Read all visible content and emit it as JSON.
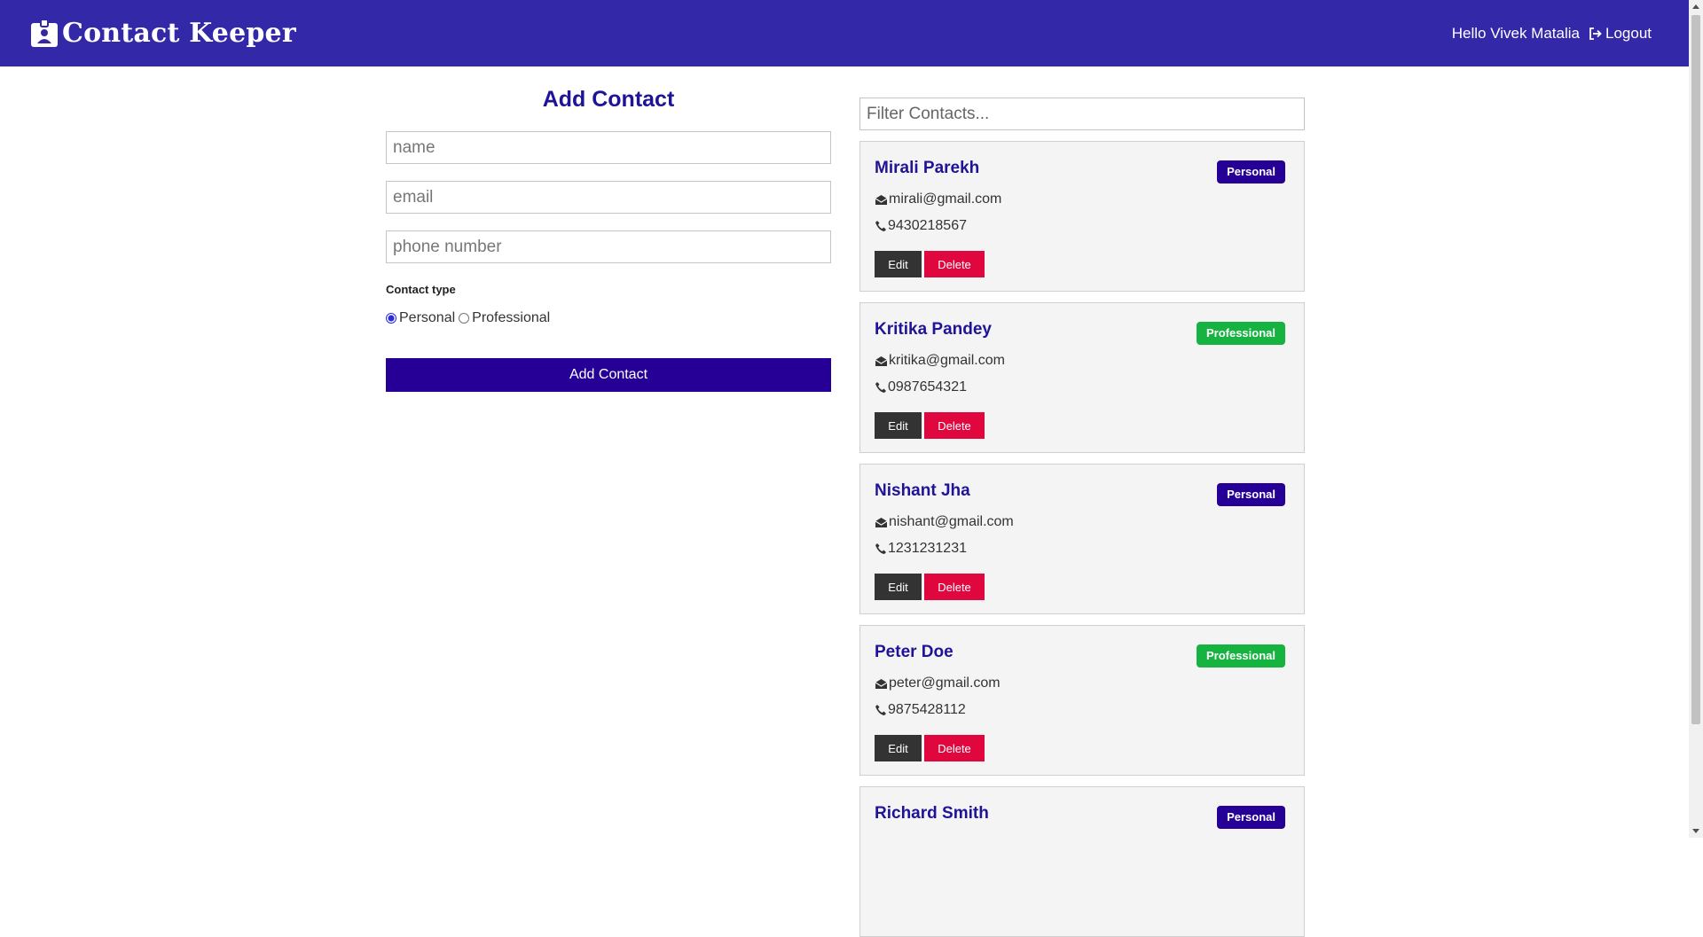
{
  "navbar": {
    "title": "Contact Keeper",
    "brand_icon": "id-badge-icon",
    "greeting": "Hello Vivek Matalia",
    "logout_label": "Logout",
    "logout_icon": "sign-out-icon"
  },
  "form": {
    "title": "Add Contact",
    "name_placeholder": "name",
    "email_placeholder": "email",
    "phone_placeholder": "phone number",
    "contact_type_label": "Contact type",
    "type_options": [
      "Personal",
      "Professional"
    ],
    "selected_type": "Personal",
    "submit_label": "Add Contact"
  },
  "filter": {
    "placeholder": "Filter Contacts..."
  },
  "contacts": [
    {
      "name": "Mirali Parekh",
      "type": "Personal",
      "email": "mirali@gmail.com",
      "phone": "9430218567"
    },
    {
      "name": "Kritika Pandey",
      "type": "Professional",
      "email": "kritika@gmail.com",
      "phone": "0987654321"
    },
    {
      "name": "Nishant Jha",
      "type": "Personal",
      "email": "nishant@gmail.com",
      "phone": "1231231231"
    },
    {
      "name": "Peter Doe",
      "type": "Professional",
      "email": "peter@gmail.com",
      "phone": "9875428112"
    },
    {
      "name": "Richard Smith",
      "type": "Personal"
    }
  ],
  "card_buttons": {
    "edit_label": "Edit",
    "delete_label": "Delete"
  },
  "colors": {
    "navbar": "#3328a7",
    "primary": "#260096",
    "success": "#17b340",
    "danger": "#e0073f",
    "dark": "#333333"
  }
}
